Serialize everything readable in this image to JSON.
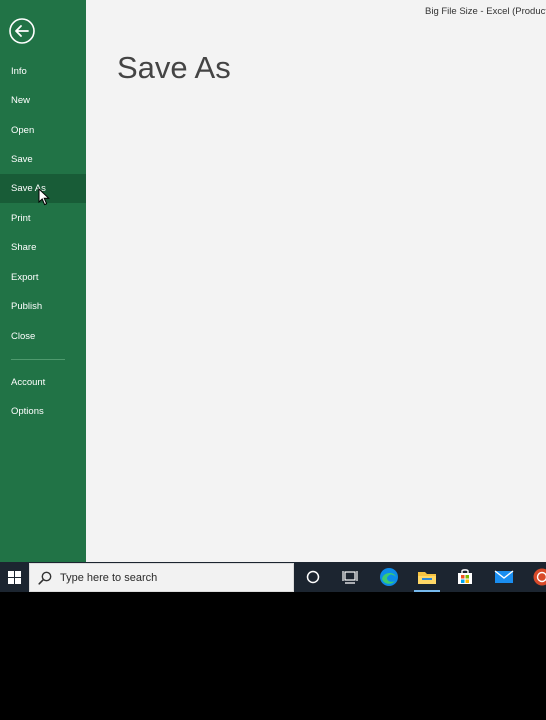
{
  "window": {
    "title": "Big File Size - Excel (Product A"
  },
  "backstage": {
    "page_title": "Save As",
    "nav_items": [
      {
        "label": "Info"
      },
      {
        "label": "New"
      },
      {
        "label": "Open"
      },
      {
        "label": "Save"
      },
      {
        "label": "Save As",
        "active": true
      },
      {
        "label": "Print"
      },
      {
        "label": "Share"
      },
      {
        "label": "Export"
      },
      {
        "label": "Publish"
      },
      {
        "label": "Close"
      },
      {
        "label": "Account"
      },
      {
        "label": "Options"
      }
    ]
  },
  "taskbar": {
    "search_placeholder": "Type here to search",
    "icons": [
      "windows-start-icon",
      "search-icon",
      "cortana-icon",
      "task-view-icon",
      "edge-icon",
      "file-explorer-icon",
      "microsoft-store-icon",
      "mail-icon",
      "app-icon"
    ]
  },
  "colors": {
    "excel_green": "#217346",
    "active_green": "#185c37",
    "taskbar": "#1c2530",
    "content_bg": "#f3f3f3"
  }
}
